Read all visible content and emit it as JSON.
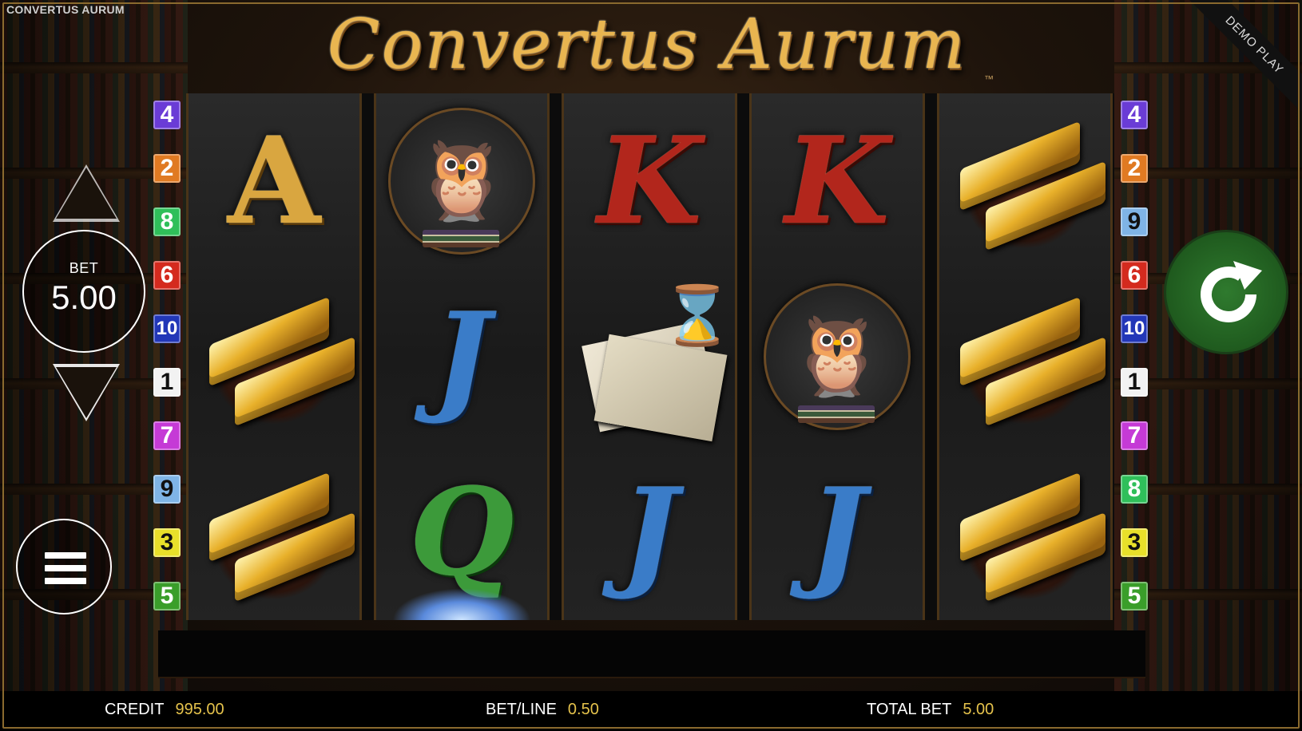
{
  "window": {
    "title": "CONVERTUS AURUM"
  },
  "logo": {
    "text": "Convertus Aurum",
    "tm": "™"
  },
  "ribbon": {
    "text": "DEMO PLAY"
  },
  "bet": {
    "label": "BET",
    "value": "5.00"
  },
  "reels": [
    [
      "A",
      "gold-bars",
      "gold-bars"
    ],
    [
      "owl",
      "J",
      "Q"
    ],
    [
      "K",
      "scroll-hourglass",
      "J"
    ],
    [
      "K",
      "owl",
      "J"
    ],
    [
      "gold-bars",
      "gold-bars",
      "gold-bars"
    ]
  ],
  "symbol_letters": {
    "A": "A",
    "K": "K",
    "J": "J",
    "Q": "Q"
  },
  "lines_left": [
    {
      "n": "4",
      "color": "#6a3cd6",
      "fg": "#ffffff"
    },
    {
      "n": "2",
      "color": "#e07a22",
      "fg": "#ffffff"
    },
    {
      "n": "8",
      "color": "#2fbf5a",
      "fg": "#ffffff"
    },
    {
      "n": "6",
      "color": "#d42a1e",
      "fg": "#ffffff"
    },
    {
      "n": "10",
      "color": "#2237b8",
      "fg": "#ffffff"
    },
    {
      "n": "1",
      "color": "#f2f2f2",
      "fg": "#111111"
    },
    {
      "n": "7",
      "color": "#c53ad6",
      "fg": "#ffffff"
    },
    {
      "n": "9",
      "color": "#7fb4e6",
      "fg": "#111111"
    },
    {
      "n": "3",
      "color": "#e8e02a",
      "fg": "#111111"
    },
    {
      "n": "5",
      "color": "#3a9e2a",
      "fg": "#ffffff"
    }
  ],
  "lines_right": [
    {
      "n": "4",
      "color": "#6a3cd6",
      "fg": "#ffffff"
    },
    {
      "n": "2",
      "color": "#e07a22",
      "fg": "#ffffff"
    },
    {
      "n": "9",
      "color": "#7fb4e6",
      "fg": "#111111"
    },
    {
      "n": "6",
      "color": "#d42a1e",
      "fg": "#ffffff"
    },
    {
      "n": "10",
      "color": "#2237b8",
      "fg": "#ffffff"
    },
    {
      "n": "1",
      "color": "#f2f2f2",
      "fg": "#111111"
    },
    {
      "n": "7",
      "color": "#c53ad6",
      "fg": "#ffffff"
    },
    {
      "n": "8",
      "color": "#2fbf5a",
      "fg": "#ffffff"
    },
    {
      "n": "3",
      "color": "#e8e02a",
      "fg": "#111111"
    },
    {
      "n": "5",
      "color": "#3a9e2a",
      "fg": "#ffffff"
    }
  ],
  "status": {
    "credit_label": "CREDIT",
    "credit_value": "995.00",
    "betline_label": "BET/LINE",
    "betline_value": "0.50",
    "totalbet_label": "TOTAL BET",
    "totalbet_value": "5.00"
  },
  "icons": {
    "bet_up": "triangle-up-icon",
    "bet_down": "triangle-down-icon",
    "menu": "hamburger-icon",
    "spin": "spin-arrow-icon"
  }
}
